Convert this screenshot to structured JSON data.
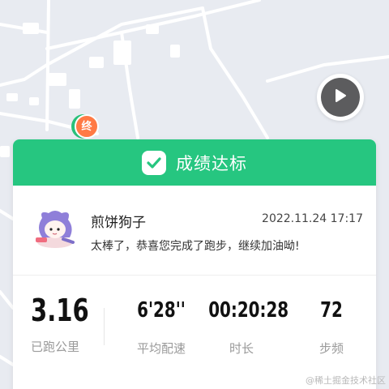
{
  "map": {
    "background_color": "#e8ebf1",
    "road_color": "#ffffff",
    "replay_icon": "play-icon",
    "end_marker_label": "终"
  },
  "header": {
    "icon": "check-badge-icon",
    "title": "成绩达标",
    "color": "#26c680"
  },
  "user": {
    "name": "煎饼狗子",
    "time": "2022.11.24 17:17",
    "message": "太棒了，恭喜您完成了跑步，继续加油呦!"
  },
  "stats": {
    "distance": {
      "value": "3.16",
      "label": "已跑公里"
    },
    "pace": {
      "value": "6'28''",
      "label": "平均配速"
    },
    "duration": {
      "value": "00:20:28",
      "label": "时长"
    },
    "cadence": {
      "value": "72",
      "label": "步频"
    }
  },
  "watermark": "@稀土掘金技术社区"
}
